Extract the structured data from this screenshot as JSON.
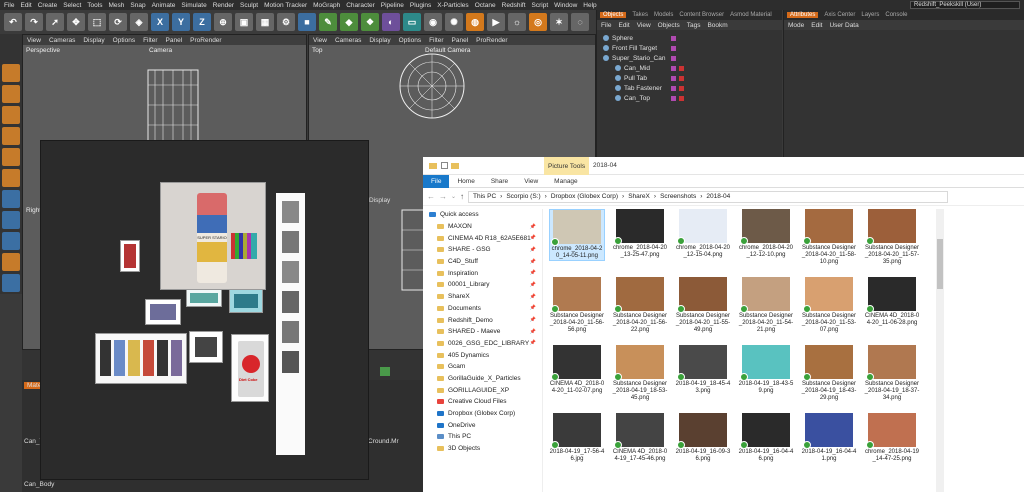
{
  "menubar": {
    "items": [
      "File",
      "Edit",
      "Create",
      "Select",
      "Tools",
      "Mesh",
      "Snap",
      "Animate",
      "Simulate",
      "Render",
      "Sculpt",
      "Motion Tracker",
      "MoGraph",
      "Character",
      "Pipeline",
      "Plugins",
      "X-Particles",
      "Octane",
      "Redshift",
      "Script",
      "Window",
      "Help"
    ],
    "layout": "Redshift_Peekskill (User)"
  },
  "toolbar": {
    "x": "X",
    "y": "Y",
    "z": "Z"
  },
  "viewport_left": {
    "menu": [
      "View",
      "Cameras",
      "Display",
      "Options",
      "Filter",
      "Panel",
      "ProRender"
    ],
    "label": "Perspective",
    "camera": "Camera"
  },
  "viewport_right": {
    "menu": [
      "View",
      "Cameras",
      "Display",
      "Options",
      "Filter",
      "Panel",
      "ProRender"
    ],
    "label": "Top",
    "camera": "Default Camera"
  },
  "viewport_lower": {
    "label": "Right",
    "menu": "Display"
  },
  "object_manager": {
    "tabs": [
      "Objects",
      "Takes",
      "Models",
      "Content Browser",
      "Asmod Material"
    ],
    "menu": [
      "File",
      "Edit",
      "View",
      "Objects",
      "Tags",
      "Bookm"
    ],
    "objects": [
      "Sphere",
      "Front Fill Target",
      "Super_Stario_Can",
      "Can_Mid",
      "Pull Tab",
      "Tab Fastener",
      "Can_Top"
    ]
  },
  "attribute_manager": {
    "tabs": [
      "Attributes",
      "Axis Center",
      "Layers",
      "Console"
    ],
    "menu": [
      "Mode",
      "Edit",
      "User Data"
    ]
  },
  "editor_panel": {
    "can_brand": "SUPER STARIO",
    "coke_label": "Diet Coke"
  },
  "material": {
    "tab": "Mate",
    "items": [
      "Can_Top",
      "Cround.Mr",
      "Can_Body"
    ]
  },
  "explorer": {
    "picture_tools": "Picture Tools",
    "title": "2018-04",
    "ribbon": [
      "File",
      "Home",
      "Share",
      "View",
      "Manage"
    ],
    "path": [
      "This PC",
      "Scorpio (S:)",
      "Dropbox (Globex Corp)",
      "ShareX",
      "Screenshots",
      "2018-04"
    ],
    "nav": [
      {
        "label": "Quick access",
        "type": "qa"
      },
      {
        "label": "MAXON",
        "type": "folder",
        "pin": true
      },
      {
        "label": "CINEMA 4D R18_62A5E681",
        "type": "folder",
        "pin": true
      },
      {
        "label": "SHARE - GSG",
        "type": "folder",
        "pin": true
      },
      {
        "label": "C4D_Stuff",
        "type": "folder",
        "pin": true
      },
      {
        "label": "Inspiration",
        "type": "folder",
        "pin": true
      },
      {
        "label": "00001_Library",
        "type": "folder",
        "pin": true
      },
      {
        "label": "ShareX",
        "type": "folder",
        "pin": true
      },
      {
        "label": "Documents",
        "type": "folder",
        "pin": true
      },
      {
        "label": "Redshift_Demo",
        "type": "folder",
        "pin": true
      },
      {
        "label": "SHARED - Maeve",
        "type": "folder",
        "pin": true
      },
      {
        "label": "0026_GSG_EDC_LIBRARY",
        "type": "folder",
        "pin": true
      },
      {
        "label": "405 Dynamics",
        "type": "folder"
      },
      {
        "label": "Gcam",
        "type": "folder"
      },
      {
        "label": "GorillaGuide_X_Particles",
        "type": "folder"
      },
      {
        "label": "GORILLAGUIDE_XP",
        "type": "folder"
      },
      {
        "label": "Creative Cloud Files",
        "type": "cloud"
      },
      {
        "label": "Dropbox (Globex Corp)",
        "type": "dropbox"
      },
      {
        "label": "OneDrive",
        "type": "onedrive"
      },
      {
        "label": "This PC",
        "type": "pc"
      },
      {
        "label": "3D Objects",
        "type": "folder"
      }
    ],
    "files": [
      {
        "name": "chrome_2018-04-20_14-05-11.png",
        "c": "#cfc7b4",
        "sel": true
      },
      {
        "name": "chrome_2018-04-20_13-25-47.png",
        "c": "#2a2a2a"
      },
      {
        "name": "chrome_2018-04-20_12-15-04.png",
        "c": "#e6ecf5"
      },
      {
        "name": "chrome_2018-04-20_12-12-10.png",
        "c": "#6d5a48"
      },
      {
        "name": "Substance Designer_2018-04-20_11-58-10.png",
        "c": "#a46a40"
      },
      {
        "name": "Substance Designer_2018-04-20_11-57-35.png",
        "c": "#9c5f3a"
      },
      {
        "name": "Substance Designer_2018-04-20_11-56-56.png",
        "c": "#b07a50"
      },
      {
        "name": "Substance Designer_2018-04-20_11-56-22.png",
        "c": "#a06a40"
      },
      {
        "name": "Substance Designer_2018-04-20_11-55-49.png",
        "c": "#8c5a38"
      },
      {
        "name": "Substance Designer_2018-04-20_11-54-21.png",
        "c": "#c4a080"
      },
      {
        "name": "Substance Designer_2018-04-20_11-53-07.png",
        "c": "#d8a070"
      },
      {
        "name": "CINEMA 4D_2018-04-20_11-06-28.png",
        "c": "#2a2a2a"
      },
      {
        "name": "CINEMA 4D_2018-04-20_11-02-07.png",
        "c": "#333"
      },
      {
        "name": "Substance Designer_2018-04-19_18-53-45.png",
        "c": "#c8905a"
      },
      {
        "name": "2018-04-19_18-45-43.png",
        "c": "#4a4a4a"
      },
      {
        "name": "2018-04-19_18-43-59.png",
        "c": "#59c2c0"
      },
      {
        "name": "Substance Designer_2018-04-19_18-43-29.png",
        "c": "#a87040"
      },
      {
        "name": "Substance Designer_2018-04-19_18-37-34.png",
        "c": "#b07850"
      },
      {
        "name": "2018-04-19_17-56-46.jpg",
        "c": "#3a3a3a"
      },
      {
        "name": "CINEMA 4D_2018-04-19_17-45-46.png",
        "c": "#444"
      },
      {
        "name": "2018-04-19_16-09-36.png",
        "c": "#5a4030"
      },
      {
        "name": "2018-04-19_16-04-46.png",
        "c": "#2a2a2a"
      },
      {
        "name": "2018-04-19_16-04-41.png",
        "c": "#3a50a0"
      },
      {
        "name": "chrome_2018-04-19_14-47-25.png",
        "c": "#c07050"
      }
    ]
  }
}
